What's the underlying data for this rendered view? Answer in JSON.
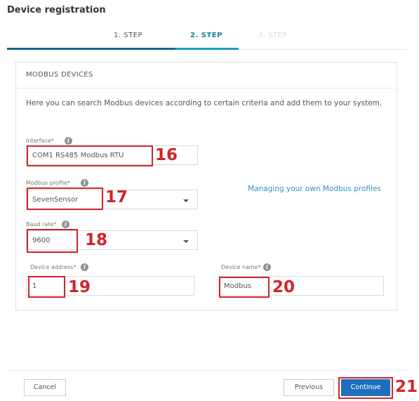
{
  "header": {
    "title": "Device registration"
  },
  "steps": [
    {
      "label": "1. STEP",
      "state": "done"
    },
    {
      "label": "2. STEP",
      "state": "active"
    },
    {
      "label": "3. STEP",
      "state": "disabled"
    }
  ],
  "card": {
    "title": "MODBUS DEVICES",
    "description": "Here you can search Modbus devices according to certain criteria and add them to your system."
  },
  "form": {
    "interface": {
      "label": "Interface*",
      "value": "COM1 RS485 Modbus RTU",
      "annotation": "16"
    },
    "modbus_profile": {
      "label": "Modbus profile*",
      "value": "SevenSensor",
      "annotation": "17"
    },
    "baud_rate": {
      "label": "Baud rate*",
      "value": "9600",
      "annotation": "18"
    },
    "device_address": {
      "label": "Device address*",
      "value": "1",
      "annotation": "19"
    },
    "device_name": {
      "label": "Device name*",
      "value": "Modbus",
      "annotation": "20"
    }
  },
  "links": {
    "manage_profiles": "Managing your own Modbus profiles"
  },
  "footer": {
    "cancel": "Cancel",
    "previous": "Previous",
    "continue": "Continue",
    "continue_annotation": "21"
  },
  "colors": {
    "accent": "#1a9fc4",
    "primary_button": "#1f6fbf",
    "annotation": "#d2232a"
  },
  "icons": {
    "info": "info-icon",
    "dropdown": "chevron-down-icon"
  }
}
